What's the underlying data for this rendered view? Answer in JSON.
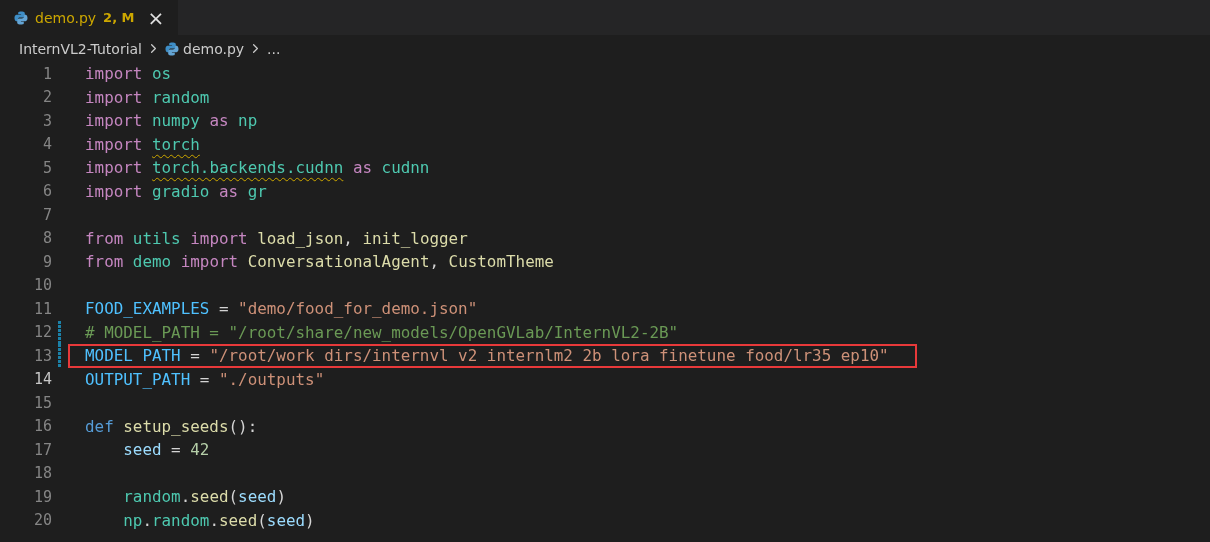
{
  "tab": {
    "filename": "demo.py",
    "badge": "2, M",
    "close": "×",
    "selected": true
  },
  "breadcrumb": {
    "folder": "InternVL2-Tutorial",
    "file": "demo.py",
    "more": "..."
  },
  "lines": [
    {
      "number": "1",
      "current": false,
      "tokens": [
        {
          "text": "import",
          "kind": "kw"
        },
        {
          "text": " os",
          "kind": "mod"
        }
      ]
    },
    {
      "number": "2",
      "current": false,
      "tokens": [
        {
          "text": "import",
          "kind": "kw"
        },
        {
          "text": " random",
          "kind": "mod"
        }
      ]
    },
    {
      "number": "3",
      "current": false,
      "tokens": [
        {
          "text": "import",
          "kind": "kw"
        },
        {
          "text": " numpy",
          "kind": "mod"
        },
        {
          "text": " as",
          "kind": "kw"
        },
        {
          "text": " np",
          "kind": "mod"
        }
      ]
    },
    {
      "number": "4",
      "current": false,
      "tokens": [
        {
          "text": "import ",
          "kind": "kw"
        },
        {
          "text": "torch",
          "kind": "mod",
          "warn": true
        }
      ]
    },
    {
      "number": "5",
      "current": false,
      "tokens": [
        {
          "text": "import ",
          "kind": "kw"
        },
        {
          "text": "torch.backends.cudnn",
          "kind": "mod",
          "warn": true
        },
        {
          "text": " as",
          "kind": "kw"
        },
        {
          "text": " cudnn",
          "kind": "mod"
        }
      ]
    },
    {
      "number": "6",
      "current": false,
      "tokens": [
        {
          "text": "import",
          "kind": "kw"
        },
        {
          "text": " gradio",
          "kind": "mod"
        },
        {
          "text": " as",
          "kind": "kw"
        },
        {
          "text": " gr",
          "kind": "mod"
        }
      ]
    },
    {
      "number": "7",
      "current": false
    },
    {
      "number": "8",
      "current": false,
      "tokens": [
        {
          "text": "from",
          "kind": "kw"
        },
        {
          "text": " utils",
          "kind": "mod"
        },
        {
          "text": " import",
          "kind": "kw"
        },
        {
          "text": " load_json",
          "kind": "func"
        },
        {
          "text": ",",
          "kind": "plain"
        },
        {
          "text": " init_logger",
          "kind": "func"
        }
      ]
    },
    {
      "number": "9",
      "current": false,
      "tokens": [
        {
          "text": "from",
          "kind": "kw"
        },
        {
          "text": " demo",
          "kind": "mod"
        },
        {
          "text": " import",
          "kind": "kw"
        },
        {
          "text": " ConversationalAgent",
          "kind": "func"
        },
        {
          "text": ",",
          "kind": "plain"
        },
        {
          "text": " CustomTheme",
          "kind": "func"
        }
      ]
    },
    {
      "number": "10",
      "current": false
    },
    {
      "number": "11",
      "current": false,
      "tokens": [
        {
          "text": "FOOD_EXAMPLES",
          "kind": "const"
        },
        {
          "text": " =",
          "kind": "plain"
        },
        {
          "text": " \"demo/food_for_demo.json\"",
          "kind": "str"
        }
      ]
    },
    {
      "number": "12",
      "current": false,
      "modified": true,
      "tokens": [
        {
          "text": "# MODEL_PATH = \"/root/share/new_models/OpenGVLab/InternVL2-2B\"",
          "kind": "cmt"
        }
      ]
    },
    {
      "number": "13",
      "current": false,
      "modified": true,
      "highlighted": true,
      "tokens": [
        {
          "text": "MODEL PATH",
          "kind": "const"
        },
        {
          "text": " =",
          "kind": "plain"
        },
        {
          "text": " \"/root/work dirs/internvl v2 internlm2 2b lora finetune food/lr35 ep10\"",
          "kind": "str"
        }
      ]
    },
    {
      "number": "14",
      "current": true,
      "tokens": [
        {
          "text": "OUTPUT_PATH",
          "kind": "const"
        },
        {
          "text": " =",
          "kind": "plain"
        },
        {
          "text": " \"./outputs\"",
          "kind": "str"
        }
      ]
    },
    {
      "number": "15",
      "current": false
    },
    {
      "number": "16",
      "current": false,
      "tokens": [
        {
          "text": "def",
          "kind": "def"
        },
        {
          "text": " setup_seeds",
          "kind": "func"
        },
        {
          "text": "():",
          "kind": "plain"
        }
      ]
    },
    {
      "number": "17",
      "current": false,
      "tokens": [
        {
          "text": "    seed",
          "kind": "var"
        },
        {
          "text": " =",
          "kind": "plain"
        },
        {
          "text": " 42",
          "kind": "num"
        }
      ]
    },
    {
      "number": "18",
      "current": false
    },
    {
      "number": "19",
      "current": false,
      "tokens": [
        {
          "text": "    random",
          "kind": "mod"
        },
        {
          "text": ".",
          "kind": "plain"
        },
        {
          "text": "seed",
          "kind": "func"
        },
        {
          "text": "(",
          "kind": "plain"
        },
        {
          "text": "seed",
          "kind": "var"
        },
        {
          "text": ")",
          "kind": "plain"
        }
      ]
    },
    {
      "number": "20",
      "current": false,
      "tokens": [
        {
          "text": "    np",
          "kind": "mod"
        },
        {
          "text": ".",
          "kind": "plain"
        },
        {
          "text": "random",
          "kind": "mod"
        },
        {
          "text": ".",
          "kind": "plain"
        },
        {
          "text": "seed",
          "kind": "func"
        },
        {
          "text": "(",
          "kind": "plain"
        },
        {
          "text": "seed",
          "kind": "var"
        },
        {
          "text": ")",
          "kind": "plain"
        }
      ]
    }
  ]
}
